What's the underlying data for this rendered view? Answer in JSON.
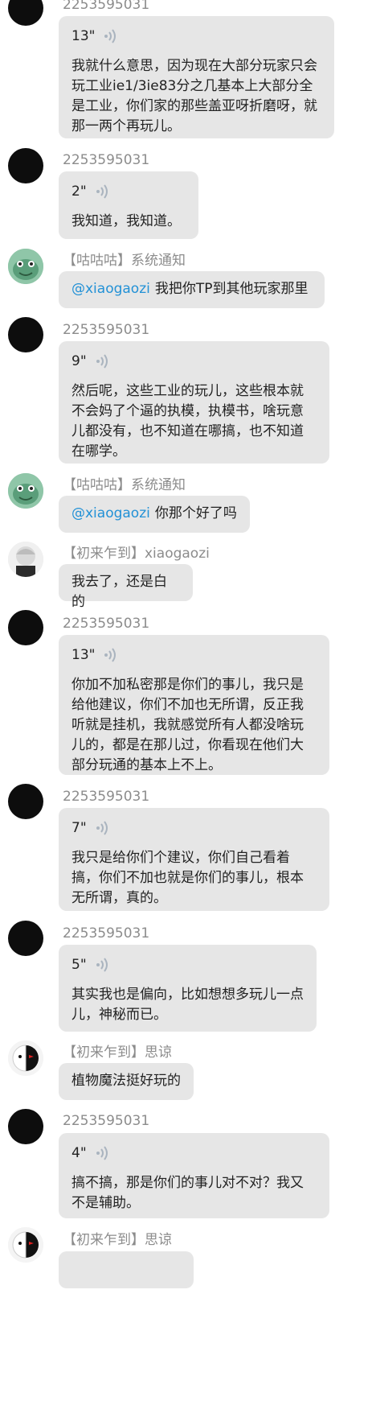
{
  "messages": [
    {
      "avatar": "black-avatar",
      "name": "2253595031",
      "duration": "13\"",
      "text": "我就什么意思，因为现在大部分玩家只会玩工业ie1/3ie83分之几基本上大部分全是工业，你们家的那些盖亚呀折磨呀，就那一两个再玩儿。"
    },
    {
      "avatar": "black-avatar",
      "name": "2253595031",
      "duration": "2\"",
      "text": "我知道，我知道。"
    },
    {
      "avatar": "frog-avatar",
      "name": "【咕咕咕】系统通知",
      "mention": "@xiaogaozi",
      "text": "我把你TP到其他玩家那里"
    },
    {
      "avatar": "black-avatar",
      "name": "2253595031",
      "duration": "9\"",
      "text": "然后呢，这些工业的玩儿，这些根本就不会妈了个逼的执模，执模书，啥玩意儿都没有，也不知道在哪搞，也不知道在哪学。"
    },
    {
      "avatar": "frog-avatar",
      "name": "【咕咕咕】系统通知",
      "mention": "@xiaogaozi",
      "text": "你那个好了吗"
    },
    {
      "avatar": "anime-avatar",
      "name": "【初来乍到】xiaogaozi",
      "text": "我去了，还是白的"
    },
    {
      "avatar": "black-avatar",
      "name": "2253595031",
      "duration": "13\"",
      "text": "你加不加私密那是你们的事儿，我只是给他建议，你们不加也无所谓，反正我听就是挂机，我就感觉所有人都没啥玩儿的，都是在那儿过，你看现在他们大部分玩通的基本上不上。"
    },
    {
      "avatar": "black-avatar",
      "name": "2253595031",
      "duration": "7\"",
      "text": "我只是给你们个建议，你们自己看着搞，你们不加也就是你们的事儿，根本无所谓，真的。"
    },
    {
      "avatar": "black-avatar",
      "name": "2253595031",
      "duration": "5\"",
      "text": "其实我也是偏向，比如想想多玩儿一点儿，神秘而已。"
    },
    {
      "avatar": "bear-avatar",
      "name": "【初来乍到】思谅",
      "text": "植物魔法挺好玩的"
    },
    {
      "avatar": "black-avatar",
      "name": "2253595031",
      "duration": "4\"",
      "text": "搞不搞，那是你们的事儿对不对？我又不是辅助。"
    },
    {
      "avatar": "bear-avatar",
      "name": "【初来乍到】思谅",
      "text": ""
    }
  ]
}
